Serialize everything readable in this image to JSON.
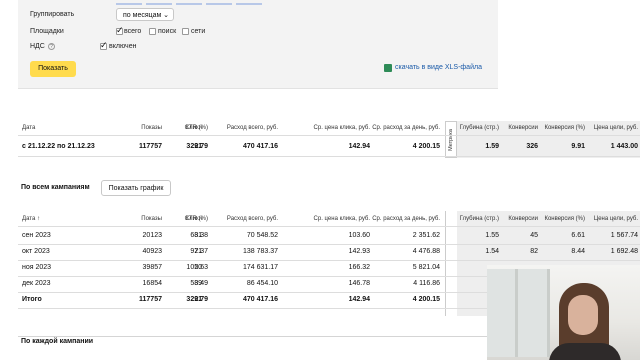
{
  "settings": {
    "group_label": "Группировать",
    "group_value": "по месяцам",
    "platforms_label": "Площадки",
    "platforms": [
      {
        "label": "всего",
        "checked": true
      },
      {
        "label": "поиск",
        "checked": false
      },
      {
        "label": "сети",
        "checked": false
      }
    ],
    "vat_label": "НДС",
    "vat_option": {
      "label": "включен",
      "checked": true
    },
    "show_button": "Показать",
    "xls_link": "скачать в виде XLS-файла"
  },
  "summary": {
    "headers": [
      "Дата",
      "Показы",
      "Клики",
      "CTR (%)",
      "Расход всего, руб.",
      "Ср. цена клика, руб.",
      "Ср. расход за день, руб.",
      "Глубина (стр.)",
      "Конверсии",
      "Конверсия (%)",
      "Цена цели, руб."
    ],
    "metrika_tab": "Метрика",
    "row": [
      "с 21.12.22 по 21.12.23",
      "117757",
      "3291",
      "2.79",
      "470 417.16",
      "142.94",
      "4 200.15",
      "1.59",
      "326",
      "9.91",
      "1 443.00"
    ]
  },
  "all_campaigns": {
    "title": "По всем кампаниям",
    "graph_button": "Показать график",
    "headers": [
      "Дата ↑",
      "Показы",
      "Клики",
      "CTR (%)",
      "Расход всего, руб.",
      "Ср. цена клика, руб.",
      "Ср. расход за день, руб.",
      "Глубина (стр.)",
      "Конверсии",
      "Конверсия (%)",
      "Цена цели, руб."
    ],
    "rows": [
      [
        "сен 2023",
        "20123",
        "681",
        "3.38",
        "70 548.52",
        "103.60",
        "2 351.62",
        "1.55",
        "45",
        "6.61",
        "1 567.74"
      ],
      [
        "окт 2023",
        "40923",
        "971",
        "2.37",
        "138 783.37",
        "142.93",
        "4 476.88",
        "1.54",
        "82",
        "8.44",
        "1 692.48"
      ],
      [
        "ноя 2023",
        "39857",
        "1050",
        "2.63",
        "174 631.17",
        "166.32",
        "5 821.04",
        "",
        "",
        "",
        ""
      ],
      [
        "дек 2023",
        "16854",
        "589",
        "3.49",
        "86 454.10",
        "146.78",
        "4 116.86",
        "",
        "",
        "",
        ""
      ]
    ],
    "total": [
      "Итого",
      "117757",
      "3291",
      "2.79",
      "470 417.16",
      "142.94",
      "4 200.15",
      "",
      "",
      "",
      ""
    ]
  },
  "each_campaign": {
    "title": "По каждой кампании"
  }
}
